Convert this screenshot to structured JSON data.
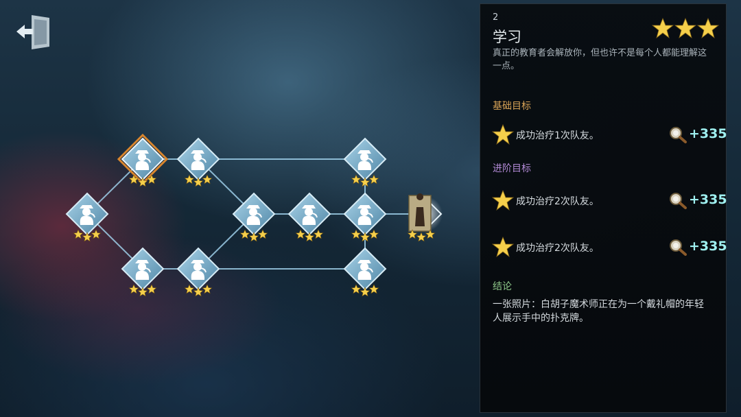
{
  "colors": {
    "node_fill": "#7fb3cf",
    "node_border": "#d7ecf6",
    "node_selected_border": "#d9862e",
    "star_gold": "#f5cf4b",
    "link_color": "#9fd0ea",
    "reward_color": "#9ff0f0",
    "basic_label_color": "#d9a457",
    "advanced_label_color": "#b28ad6",
    "conclusion_label_color": "#8fc98a"
  },
  "icons": {
    "exit": "exit-door-icon",
    "node": "detective-silhouette-icon",
    "star": "star-icon",
    "clue": "magnifier-clue-icon"
  },
  "graph": {
    "nodes": [
      {
        "id": "n1",
        "stars": 3,
        "selected": false,
        "type": "chapter"
      },
      {
        "id": "n2",
        "stars": 3,
        "selected": true,
        "type": "chapter"
      },
      {
        "id": "n3",
        "stars": 3,
        "selected": false,
        "type": "chapter"
      },
      {
        "id": "n4",
        "stars": 3,
        "selected": false,
        "type": "chapter"
      },
      {
        "id": "n5",
        "stars": 3,
        "selected": false,
        "type": "chapter"
      },
      {
        "id": "n6",
        "stars": 3,
        "selected": false,
        "type": "chapter"
      },
      {
        "id": "n7",
        "stars": 3,
        "selected": false,
        "type": "chapter"
      },
      {
        "id": "n8",
        "stars": 3,
        "selected": false,
        "type": "chapter"
      },
      {
        "id": "n9",
        "stars": 3,
        "selected": false,
        "type": "chapter"
      },
      {
        "id": "n10",
        "stars": 3,
        "selected": false,
        "type": "chapter"
      },
      {
        "id": "n11",
        "stars": 3,
        "selected": false,
        "type": "chapter"
      },
      {
        "id": "n12",
        "stars": 3,
        "selected": false,
        "type": "portrait"
      }
    ],
    "links": [
      [
        "n1",
        "n2"
      ],
      [
        "n1",
        "n4"
      ],
      [
        "n2",
        "n3"
      ],
      [
        "n3",
        "n6"
      ],
      [
        "n4",
        "n5"
      ],
      [
        "n5",
        "n6"
      ],
      [
        "n6",
        "n7"
      ],
      [
        "n7",
        "n8"
      ],
      [
        "n3",
        "n9"
      ],
      [
        "n9",
        "n8"
      ],
      [
        "n5",
        "n10"
      ],
      [
        "n10",
        "n8"
      ],
      [
        "n8",
        "n12"
      ]
    ]
  },
  "panel": {
    "chapter_number": "2",
    "chapter_title": "学习",
    "stars": 3,
    "description": "真正的教育者会解放你，但也许不是每个人都能理解这一点。",
    "basic_label": "基础目标",
    "advanced_label": "进阶目标",
    "conclusion_label": "结论",
    "objectives": {
      "basic": [
        {
          "text": "成功治疗1次队友。",
          "reward": "+335"
        }
      ],
      "advanced": [
        {
          "text": "成功治疗2次队友。",
          "reward": "+335"
        },
        {
          "text": "成功治疗2次队友。",
          "reward": "+335"
        }
      ]
    },
    "conclusion": "一张照片：白胡子魔术师正在为一个戴礼帽的年轻人展示手中的扑克牌。"
  }
}
